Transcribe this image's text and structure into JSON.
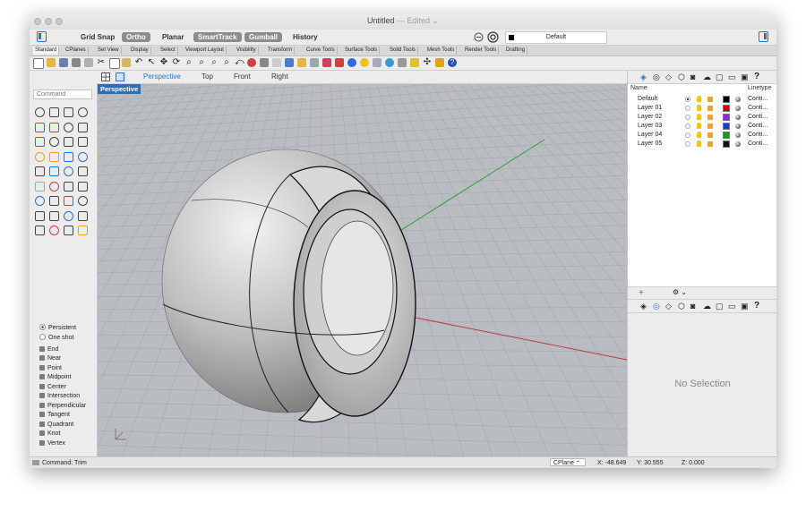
{
  "window": {
    "title": "Untitled",
    "status": "Edited"
  },
  "toolbar": {
    "grid_snap": "Grid Snap",
    "ortho": "Ortho",
    "planar": "Planar",
    "smarttrack": "SmartTrack",
    "gumball": "Gumball",
    "history": "History",
    "current_layer": "Default"
  },
  "tool_tabs": [
    "Standard",
    "CPlanes",
    "Set View",
    "Display",
    "Select",
    "Viewport Layout",
    "Visibility",
    "Transform",
    "Curve Tools",
    "Surface Tools",
    "Solid Tools",
    "Mesh Tools",
    "Render Tools",
    "Drafting"
  ],
  "viewport_tabs": [
    "Perspective",
    "Top",
    "Front",
    "Right"
  ],
  "viewport": {
    "label": "Perspective"
  },
  "command": {
    "placeholder": "Command"
  },
  "osnap": {
    "modes": [
      "Persistent",
      "One shot"
    ],
    "items": [
      "End",
      "Near",
      "Point",
      "Midpoint",
      "Center",
      "Intersection",
      "Perpendicular",
      "Tangent",
      "Quadrant",
      "Knot",
      "Vertex"
    ]
  },
  "layers": {
    "columns": [
      "Name",
      "Linetype"
    ],
    "rows": [
      {
        "name": "Default",
        "color": "#000000",
        "linetype": "Conti..."
      },
      {
        "name": "Layer 01",
        "color": "#cc0000",
        "linetype": "Conti..."
      },
      {
        "name": "Layer 02",
        "color": "#8a2be2",
        "linetype": "Conti..."
      },
      {
        "name": "Layer 03",
        "color": "#1a3ad8",
        "linetype": "Conti..."
      },
      {
        "name": "Layer 04",
        "color": "#10a010",
        "linetype": "Conti..."
      },
      {
        "name": "Layer 05",
        "color": "#111111",
        "linetype": "Conti..."
      }
    ]
  },
  "properties": {
    "empty": "No Selection"
  },
  "status": {
    "command": "Command: Trim",
    "cplane": "CPlane",
    "x": "X: -48.649",
    "y": "Y: 30.555",
    "z": "Z: 0.000"
  }
}
